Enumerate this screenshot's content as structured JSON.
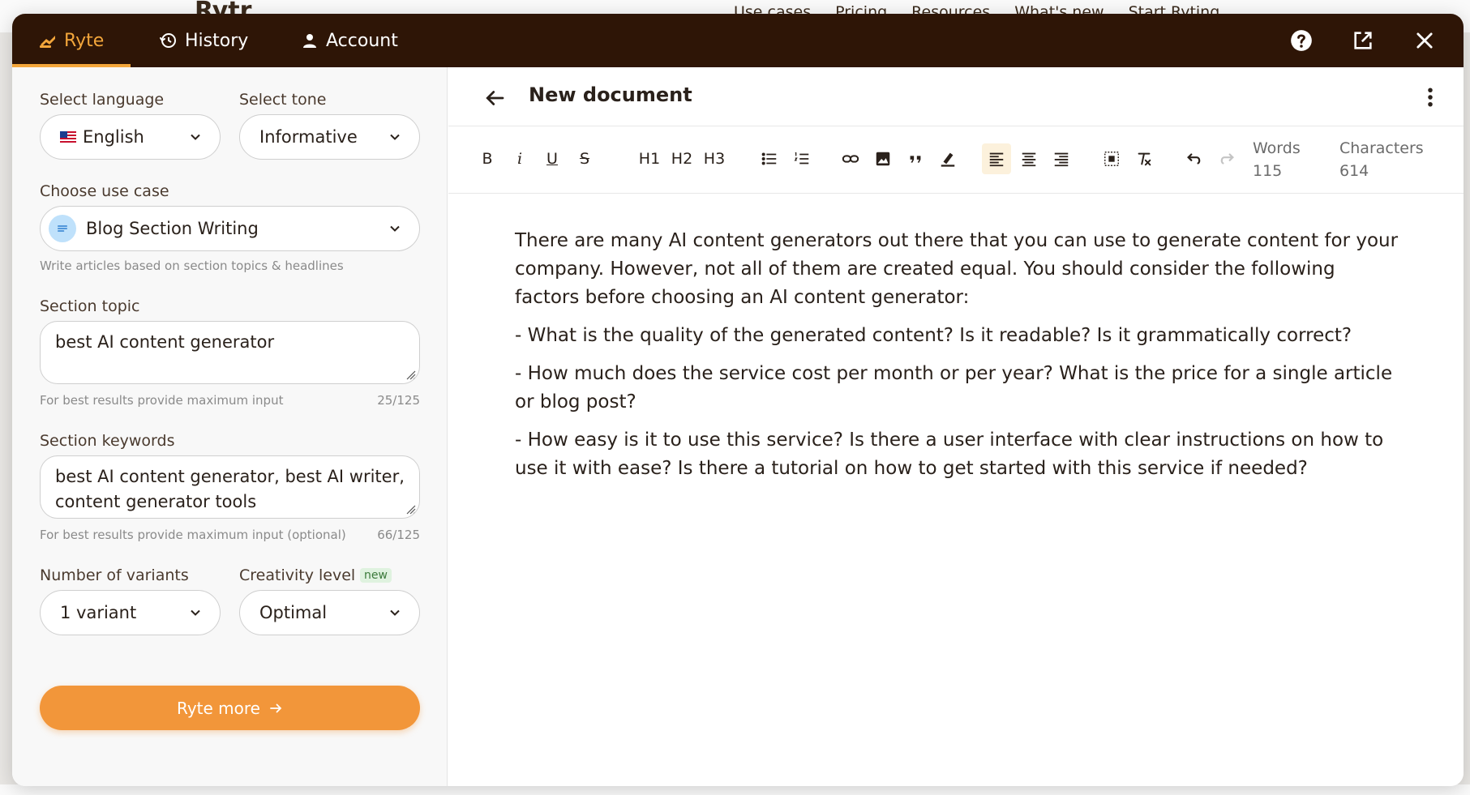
{
  "background": {
    "logo": "Rytr",
    "nav": [
      "Use cases",
      "Pricing",
      "Resources",
      "What's new",
      "Start Ryting"
    ]
  },
  "tabs": [
    {
      "label": "Ryte",
      "icon": "hand-write-icon",
      "active": true
    },
    {
      "label": "History",
      "icon": "history-icon",
      "active": false
    },
    {
      "label": "Account",
      "icon": "user-icon",
      "active": false
    }
  ],
  "form": {
    "language_label": "Select language",
    "language_value": "English",
    "tone_label": "Select tone",
    "tone_value": "Informative",
    "usecase_label": "Choose use case",
    "usecase_value": "Blog Section Writing",
    "usecase_help": "Write articles based on section topics & headlines",
    "topic_label": "Section topic",
    "topic_value": "best AI content generator",
    "topic_help": "For best results provide maximum input",
    "topic_counter": "25/125",
    "keywords_label": "Section keywords",
    "keywords_value": "best AI content generator, best AI writer, content generator tools",
    "keywords_help": "For best results provide maximum input (optional)",
    "keywords_counter": "66/125",
    "variants_label": "Number of variants",
    "variants_value": "1 variant",
    "creativity_label": "Creativity level",
    "creativity_badge": "new",
    "creativity_value": "Optimal",
    "cta_label": "Ryte more"
  },
  "document": {
    "title": "New document",
    "words_label": "Words",
    "words_value": "115",
    "chars_label": "Characters",
    "chars_value": "614",
    "paragraphs": [
      "There are many AI content generators out there that you can use to generate content for your company. However, not all of them are created equal. You should consider the following factors before choosing an AI content generator:",
      "- What is the quality of the generated content? Is it readable? Is it grammatically correct?",
      "- How much does the service cost per month or per year? What is the price for a single article or blog post?",
      "- How easy is it to use this service? Is there a user interface with clear instructions on how to use it with ease? Is there a tutorial on how to get started with this service if needed?"
    ]
  },
  "toolbar": {
    "bold": "B",
    "italic": "i",
    "underline": "U",
    "strike": "S",
    "h1": "H1",
    "h2": "H2",
    "h3": "H3"
  },
  "colors": {
    "topbar": "#2e1506",
    "accent": "#f3a63b",
    "cta": "#f2963a"
  }
}
